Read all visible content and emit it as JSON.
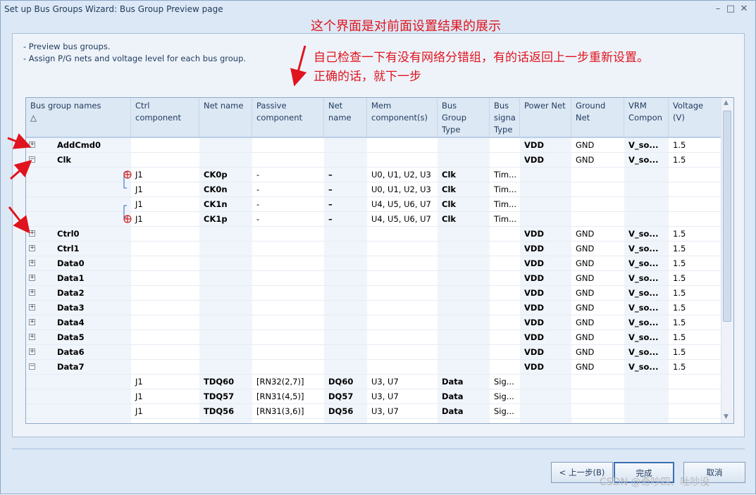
{
  "window": {
    "title": "Set up Bus Groups Wizard: Bus Group Preview page",
    "controls": [
      "–",
      "□",
      "✕"
    ]
  },
  "description": [
    "- Preview bus groups.",
    "- Assign P/G nets and voltage level for each bus group."
  ],
  "annotations": [
    "这个界面是对前面设置结果的展示",
    "自己检查一下有没有网络分错组，有的话返回上一步重新设置。",
    "正确的话，就下一步"
  ],
  "columns": [
    {
      "label": "Bus group names\n△"
    },
    {
      "label": "Ctrl\ncomponent"
    },
    {
      "label": "Net name"
    },
    {
      "label": "Passive\ncomponent"
    },
    {
      "label": "Net\nname"
    },
    {
      "label": "Mem\ncomponent(s)"
    },
    {
      "label": "Bus\nGroup\nType"
    },
    {
      "label": "Bus\nsigna\nType"
    },
    {
      "label": "Power Net"
    },
    {
      "label": "Ground\nNet"
    },
    {
      "label": "VRM\nCompon"
    },
    {
      "label": "Voltage\n(V)"
    }
  ],
  "rows": [
    {
      "kind": "group",
      "expand": "+",
      "name": "AddCmd0",
      "power": "VDD",
      "ground": "GND",
      "vrm": "V_so...",
      "voltage": "1.5"
    },
    {
      "kind": "group",
      "expand": "−",
      "name": "Clk",
      "power": "VDD",
      "ground": "GND",
      "vrm": "V_so...",
      "voltage": "1.5"
    },
    {
      "kind": "net",
      "pair": "top-red",
      "ctrl": "J1",
      "net": "CK0p",
      "passive": "-",
      "net2": "–",
      "mem": "U0, U1, U2, U3",
      "type": "Clk",
      "sig": "Tim..."
    },
    {
      "kind": "net",
      "pair": "bottom",
      "ctrl": "J1",
      "net": "CK0n",
      "passive": "-",
      "net2": "–",
      "mem": "U0, U1, U2, U3",
      "type": "Clk",
      "sig": "Tim..."
    },
    {
      "kind": "net",
      "pair": "top",
      "ctrl": "J1",
      "net": "CK1n",
      "passive": "-",
      "net2": "–",
      "mem": "U4, U5, U6, U7",
      "type": "Clk",
      "sig": "Tim..."
    },
    {
      "kind": "net",
      "pair": "bottom-red",
      "ctrl": "J1",
      "net": "CK1p",
      "passive": "-",
      "net2": "–",
      "mem": "U4, U5, U6, U7",
      "type": "Clk",
      "sig": "Tim..."
    },
    {
      "kind": "group",
      "expand": "+",
      "name": "Ctrl0",
      "power": "VDD",
      "ground": "GND",
      "vrm": "V_so...",
      "voltage": "1.5"
    },
    {
      "kind": "group",
      "expand": "+",
      "name": "Ctrl1",
      "power": "VDD",
      "ground": "GND",
      "vrm": "V_so...",
      "voltage": "1.5"
    },
    {
      "kind": "group",
      "expand": "+",
      "name": "Data0",
      "power": "VDD",
      "ground": "GND",
      "vrm": "V_so...",
      "voltage": "1.5"
    },
    {
      "kind": "group",
      "expand": "+",
      "name": "Data1",
      "power": "VDD",
      "ground": "GND",
      "vrm": "V_so...",
      "voltage": "1.5"
    },
    {
      "kind": "group",
      "expand": "+",
      "name": "Data2",
      "power": "VDD",
      "ground": "GND",
      "vrm": "V_so...",
      "voltage": "1.5"
    },
    {
      "kind": "group",
      "expand": "+",
      "name": "Data3",
      "power": "VDD",
      "ground": "GND",
      "vrm": "V_so...",
      "voltage": "1.5"
    },
    {
      "kind": "group",
      "expand": "+",
      "name": "Data4",
      "power": "VDD",
      "ground": "GND",
      "vrm": "V_so...",
      "voltage": "1.5"
    },
    {
      "kind": "group",
      "expand": "+",
      "name": "Data5",
      "power": "VDD",
      "ground": "GND",
      "vrm": "V_so...",
      "voltage": "1.5"
    },
    {
      "kind": "group",
      "expand": "+",
      "name": "Data6",
      "power": "VDD",
      "ground": "GND",
      "vrm": "V_so...",
      "voltage": "1.5"
    },
    {
      "kind": "group",
      "expand": "−",
      "name": "Data7",
      "power": "VDD",
      "ground": "GND",
      "vrm": "V_so...",
      "voltage": "1.5"
    },
    {
      "kind": "net",
      "ctrl": "J1",
      "net": "TDQ60",
      "passive": "[RN32(2,7)]",
      "net2": "DQ60",
      "mem": "U3, U7",
      "type": "Data",
      "sig": "Sig..."
    },
    {
      "kind": "net",
      "ctrl": "J1",
      "net": "TDQ57",
      "passive": "[RN31(4,5)]",
      "net2": "DQ57",
      "mem": "U3, U7",
      "type": "Data",
      "sig": "Sig..."
    },
    {
      "kind": "net",
      "ctrl": "J1",
      "net": "TDQ56",
      "passive": "[RN31(3,6)]",
      "net2": "DQ56",
      "mem": "U3, U7",
      "type": "Data",
      "sig": "Sig..."
    }
  ],
  "buttons": {
    "back": "< 上一步(B)",
    "finish": "完成",
    "cancel": "取消"
  },
  "watermark": "CSDN @奇吵四、吐吵没",
  "colors": {
    "annotation": "#e0141e",
    "header_bg": "#dde8f5",
    "window_bg": "#dce8f5"
  }
}
